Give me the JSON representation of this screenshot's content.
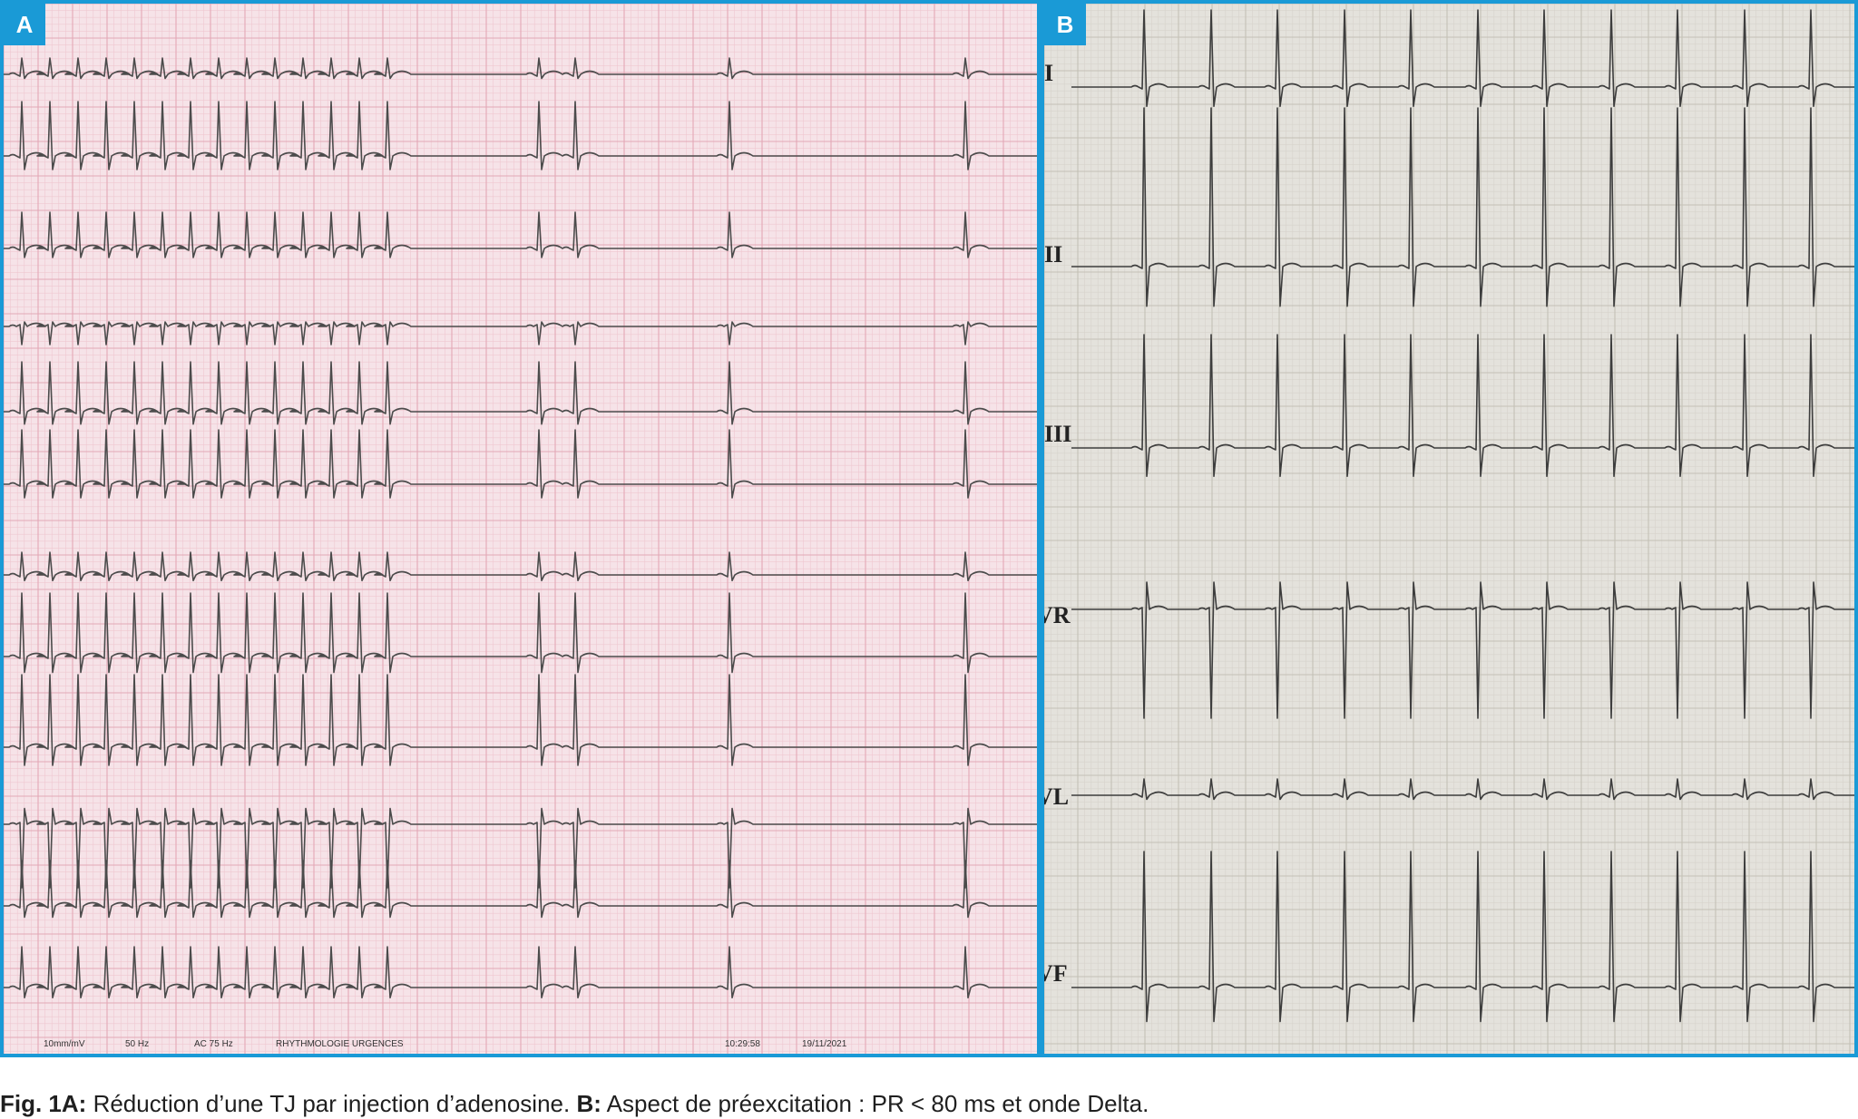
{
  "panel_a": {
    "label": "A",
    "strip_texts": [
      "10mm/mV",
      "50 Hz",
      "AC 75 Hz",
      "RHYTHMOLOGIE URGENCES",
      "10:29:58",
      "19/11/2021"
    ]
  },
  "panel_b": {
    "label": "B",
    "leads": [
      "I",
      "II",
      "III",
      "aVR",
      "aVL",
      "aVF"
    ]
  },
  "caption": {
    "fig_label": "Fig. 1A:",
    "a_text": " Réduction d’une TJ par injection d’adenosine. ",
    "b_label": "B:",
    "b_text": " Aspect de préexcitation : PR < 80 ms et onde Delta."
  }
}
